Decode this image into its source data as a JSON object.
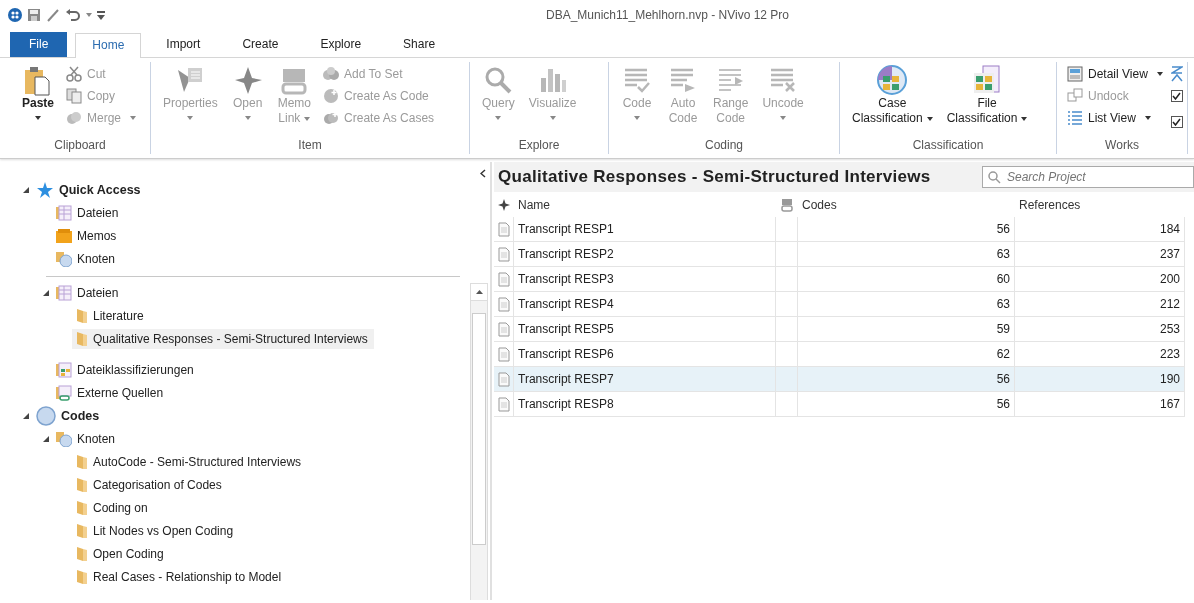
{
  "window": {
    "title": "DBA_Munich11_Mehlhorn.nvp - NVivo 12 Pro"
  },
  "ribbon_tabs": [
    {
      "label": "File",
      "kind": "file",
      "selected": false
    },
    {
      "label": "Home",
      "kind": "tab",
      "selected": true
    },
    {
      "label": "Import",
      "kind": "tab",
      "selected": false
    },
    {
      "label": "Create",
      "kind": "tab",
      "selected": false
    },
    {
      "label": "Explore",
      "kind": "tab",
      "selected": false
    },
    {
      "label": "Share",
      "kind": "tab",
      "selected": false
    }
  ],
  "ribbon_groups": [
    {
      "label": "Clipboard",
      "items": [
        {
          "kind": "large",
          "label": "Paste",
          "disabled": false,
          "dropdown": true
        },
        {
          "kind": "stack",
          "items": [
            {
              "label": "Cut",
              "disabled": true,
              "dropdown": false
            },
            {
              "label": "Copy",
              "disabled": true,
              "dropdown": false
            },
            {
              "label": "Merge",
              "disabled": true,
              "dropdown": true
            }
          ]
        }
      ]
    },
    {
      "label": "Item",
      "items": [
        {
          "kind": "large",
          "label": "Properties",
          "disabled": true,
          "dropdown": true
        },
        {
          "kind": "large",
          "label": "Open",
          "disabled": true,
          "dropdown": true
        },
        {
          "kind": "large",
          "label": "Memo\nLink",
          "disabled": true,
          "dropdown": true
        },
        {
          "kind": "stack",
          "items": [
            {
              "label": "Add To Set",
              "disabled": true,
              "dropdown": false
            },
            {
              "label": "Create As Code",
              "disabled": true,
              "dropdown": false
            },
            {
              "label": "Create As Cases",
              "disabled": true,
              "dropdown": false
            }
          ]
        }
      ]
    },
    {
      "label": "Explore",
      "items": [
        {
          "kind": "large",
          "label": "Query",
          "disabled": true,
          "dropdown": true
        },
        {
          "kind": "large",
          "label": "Visualize",
          "disabled": true,
          "dropdown": true
        }
      ]
    },
    {
      "label": "Coding",
      "items": [
        {
          "kind": "large",
          "label": "Code",
          "disabled": true,
          "dropdown": true
        },
        {
          "kind": "large",
          "label": "Auto\nCode",
          "disabled": true,
          "dropdown": false
        },
        {
          "kind": "large",
          "label": "Range\nCode",
          "disabled": true,
          "dropdown": false
        },
        {
          "kind": "large",
          "label": "Uncode",
          "disabled": true,
          "dropdown": true
        }
      ]
    },
    {
      "label": "Classification",
      "items": [
        {
          "kind": "large",
          "label": "Case\nClassification",
          "disabled": false,
          "dropdown": true
        },
        {
          "kind": "large",
          "label": "File\nClassification",
          "disabled": false,
          "dropdown": true
        }
      ]
    },
    {
      "label": "Works",
      "items": [
        {
          "kind": "stack",
          "items": [
            {
              "label": "Detail View",
              "disabled": false,
              "dropdown": true
            },
            {
              "label": "Undock",
              "disabled": true,
              "dropdown": false
            },
            {
              "label": "List View",
              "disabled": false,
              "dropdown": true
            }
          ]
        },
        {
          "kind": "checks",
          "items": [
            {
              "checked": true
            },
            {
              "checked": true
            }
          ]
        }
      ]
    }
  ],
  "navigation": {
    "quick_access": {
      "label": "Quick Access",
      "kind": "star",
      "expanded": true,
      "children": [
        {
          "label": "Dateien",
          "kind": "files"
        },
        {
          "label": "Memos",
          "kind": "memos"
        },
        {
          "label": "Knoten",
          "kind": "nodes"
        }
      ]
    },
    "tree": [
      {
        "kind": "group",
        "children": [
          {
            "label": "Dateien",
            "kind": "files",
            "expanded": true,
            "children": [
              {
                "label": "Literature",
                "kind": "folder",
                "selected": false
              },
              {
                "label": "Qualitative Responses - Semi-Structured Interviews",
                "kind": "folder",
                "selected": true
              }
            ]
          },
          {
            "label": "Dateiklassifizierungen",
            "kind": "classifications"
          },
          {
            "label": "Externe Quellen",
            "kind": "externals"
          }
        ]
      },
      {
        "label": "Codes",
        "kind": "codes",
        "expanded": true,
        "children": [
          {
            "label": "Knoten",
            "kind": "nodes",
            "expanded": true,
            "children": [
              {
                "label": "AutoCode - Semi-Structured Interviews",
                "kind": "folder",
                "selected": false
              },
              {
                "label": "Categorisation of Codes",
                "kind": "folder",
                "selected": false
              },
              {
                "label": "Coding on",
                "kind": "folder",
                "selected": false
              },
              {
                "label": "Lit Nodes vs Open Coding",
                "kind": "folder",
                "selected": false
              },
              {
                "label": "Open Coding",
                "kind": "folder",
                "selected": false
              },
              {
                "label": "Real Cases - Relationship to Model",
                "kind": "folder",
                "selected": false
              }
            ]
          }
        ]
      }
    ]
  },
  "list_view": {
    "title": "Qualitative Responses - Semi-Structured Interviews",
    "search": {
      "placeholder": "Search Project"
    },
    "columns": [
      "Name",
      "Codes",
      "References"
    ],
    "rows": [
      {
        "name": "Transcript RESP1",
        "codes": "56",
        "references": "184",
        "selected": false
      },
      {
        "name": "Transcript RESP2",
        "codes": "63",
        "references": "237",
        "selected": false
      },
      {
        "name": "Transcript RESP3",
        "codes": "60",
        "references": "200",
        "selected": false
      },
      {
        "name": "Transcript RESP4",
        "codes": "63",
        "references": "212",
        "selected": false
      },
      {
        "name": "Transcript RESP5",
        "codes": "59",
        "references": "253",
        "selected": false
      },
      {
        "name": "Transcript RESP6",
        "codes": "62",
        "references": "223",
        "selected": false
      },
      {
        "name": "Transcript RESP7",
        "codes": "56",
        "references": "190",
        "selected": true
      },
      {
        "name": "Transcript RESP8",
        "codes": "56",
        "references": "167",
        "selected": false
      }
    ]
  }
}
